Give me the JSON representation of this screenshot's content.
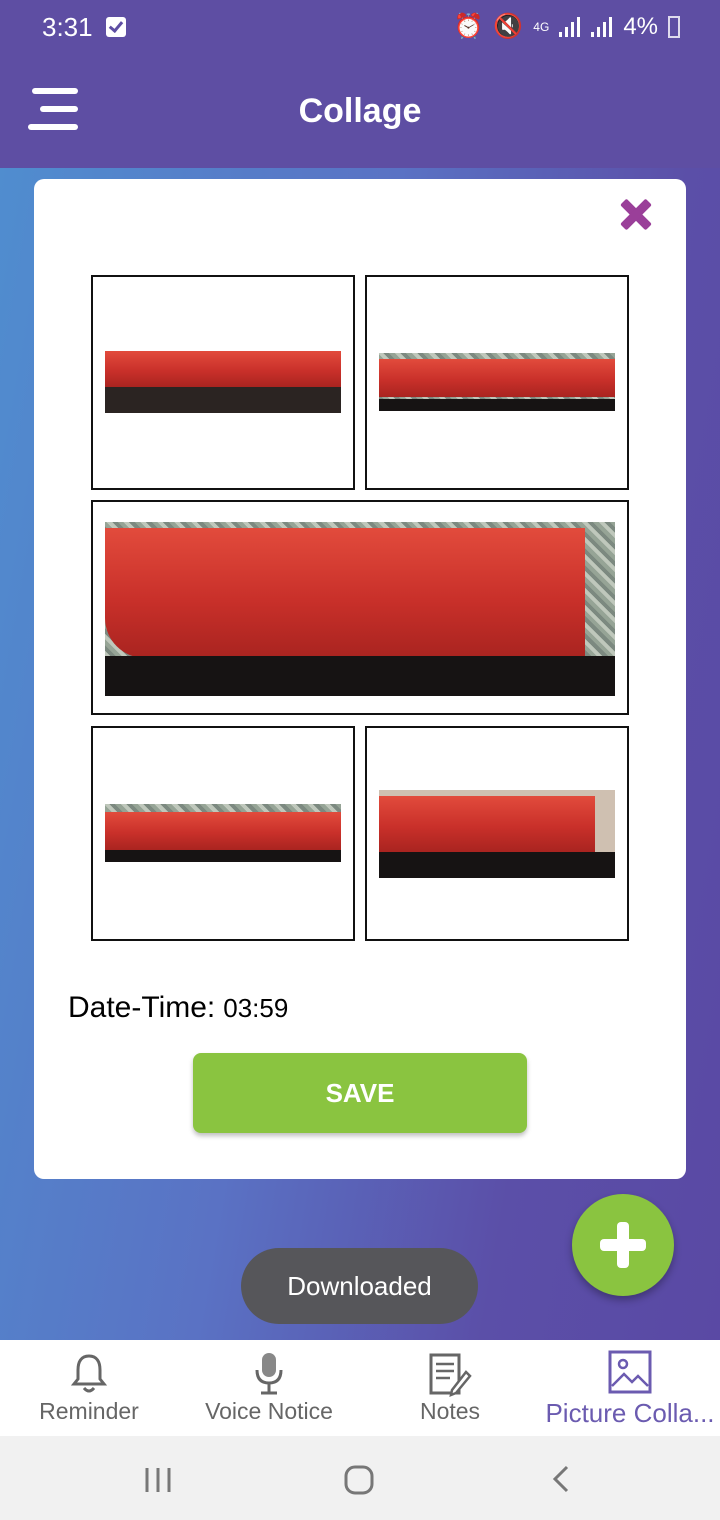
{
  "status": {
    "time": "3:31",
    "battery": "4%",
    "network": "4G"
  },
  "appbar": {
    "title": "Collage"
  },
  "card": {
    "datetime_label": "Date-Time:",
    "datetime_value": "03:59",
    "save_label": "SAVE"
  },
  "toast": {
    "text": "Downloaded"
  },
  "bottom_nav": {
    "items": [
      {
        "label": "Reminder",
        "icon": "bell-icon",
        "active": false
      },
      {
        "label": "Voice Notice",
        "icon": "microphone-icon",
        "active": false
      },
      {
        "label": "Notes",
        "icon": "notes-icon",
        "active": false
      },
      {
        "label": "Picture Colla...",
        "icon": "picture-icon",
        "active": true
      }
    ]
  },
  "colors": {
    "primary": "#5e4ea3",
    "accent": "#8ac440",
    "close": "#9a3f99"
  }
}
